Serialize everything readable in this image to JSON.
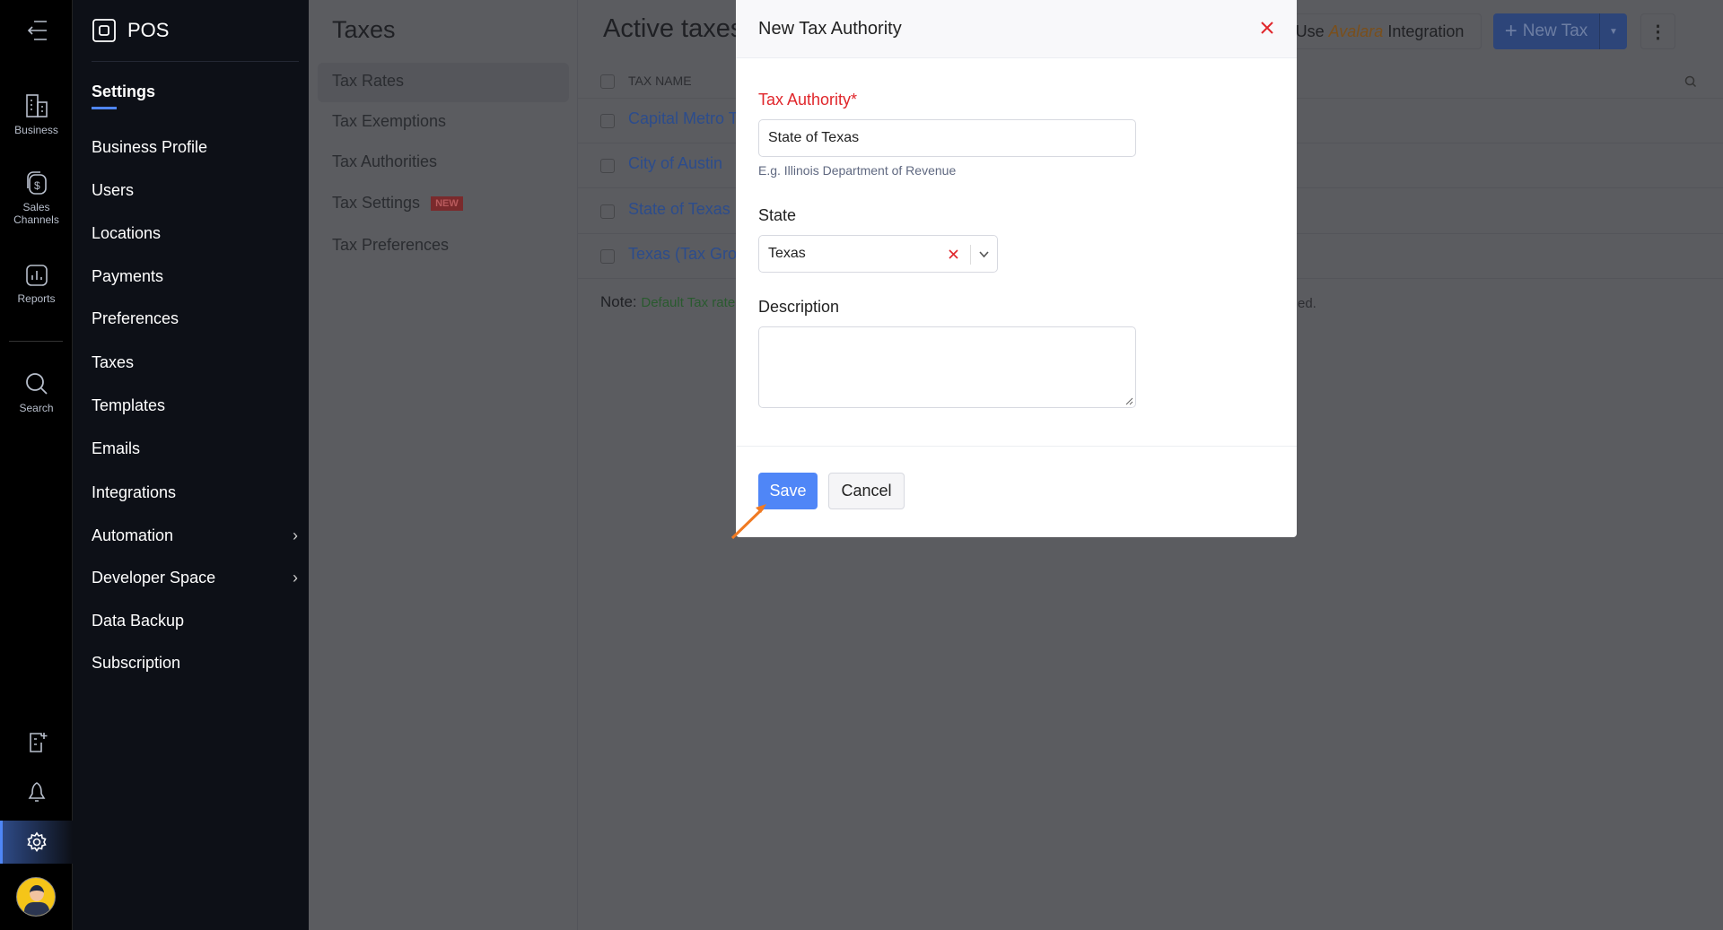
{
  "rail": {
    "business": "Business",
    "sales_1": "Sales",
    "sales_2": "Channels",
    "reports": "Reports",
    "search": "Search"
  },
  "sidebar": {
    "app_name": "POS",
    "section": "Settings",
    "items": [
      "Business Profile",
      "Users",
      "Locations",
      "Payments",
      "Preferences",
      "Taxes",
      "Templates",
      "Emails",
      "Integrations",
      "Automation",
      "Developer Space",
      "Data Backup",
      "Subscription"
    ]
  },
  "subnav": {
    "title": "Taxes",
    "items": [
      "Tax Rates",
      "Tax Exemptions",
      "Tax Authorities",
      "Tax Settings",
      "Tax Preferences"
    ],
    "badge": "NEW"
  },
  "main": {
    "title": "Active taxes",
    "avalara_prefix": "Use ",
    "avalara_brand": "Avalara",
    "avalara_suffix": " Integration",
    "new_tax": "New Tax",
    "column": "TAX NAME",
    "rows": [
      "Capital Metro Transit",
      "City of Austin",
      "State of Texas",
      "Texas (Tax Group)"
    ],
    "note_label": "Note:",
    "note_text": "Default Tax rate",
    "note_tail": "ed."
  },
  "modal": {
    "title": "New Tax Authority",
    "authority_label": "Tax Authority*",
    "authority_value": "State of Texas",
    "authority_hint": "E.g. Illinois Department of Revenue",
    "state_label": "State",
    "state_value": "Texas",
    "description_label": "Description",
    "description_value": "",
    "save": "Save",
    "cancel": "Cancel"
  },
  "colors": {
    "accent": "#4f86f7",
    "required": "#e0262b",
    "annotation": "#f07a22"
  }
}
